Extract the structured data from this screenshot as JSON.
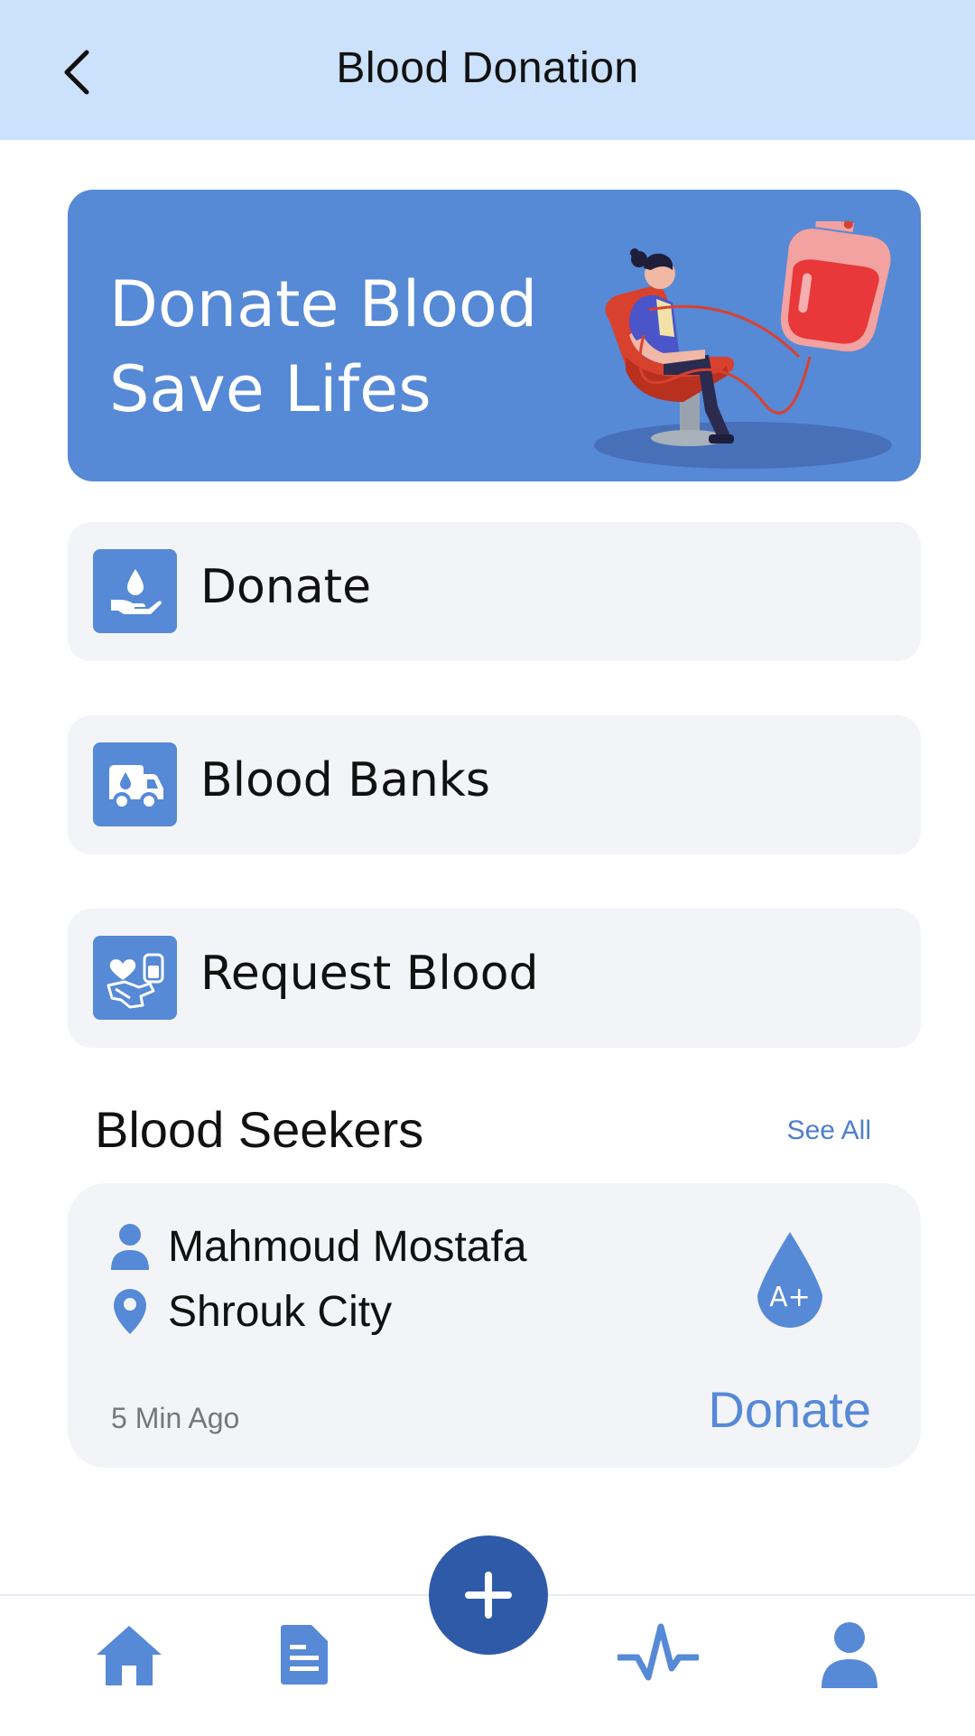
{
  "header": {
    "title": "Blood Donation",
    "back_icon": "chevron-left-icon"
  },
  "banner": {
    "line1": "Donate Blood",
    "line2": "Save Lifes"
  },
  "menu": [
    {
      "label": "Donate",
      "icon": "hand-drop-icon"
    },
    {
      "label": "Blood Banks",
      "icon": "ambulance-icon"
    },
    {
      "label": "Request Blood",
      "icon": "request-blood-icon"
    }
  ],
  "seekers": {
    "title": "Blood Seekers",
    "see_all": "See All",
    "items": [
      {
        "name": "Mahmoud Mostafa",
        "location": "Shrouk City",
        "time": "5 Min Ago",
        "blood_type": "A+",
        "action": "Donate"
      }
    ]
  },
  "nav": {
    "items": [
      "home-icon",
      "document-icon",
      "add-icon",
      "activity-icon",
      "profile-icon"
    ]
  },
  "colors": {
    "accent": "#5689d6",
    "header_bg": "#cce1fb",
    "fab": "#2f5aa8",
    "card_bg": "#f3f4f8"
  }
}
